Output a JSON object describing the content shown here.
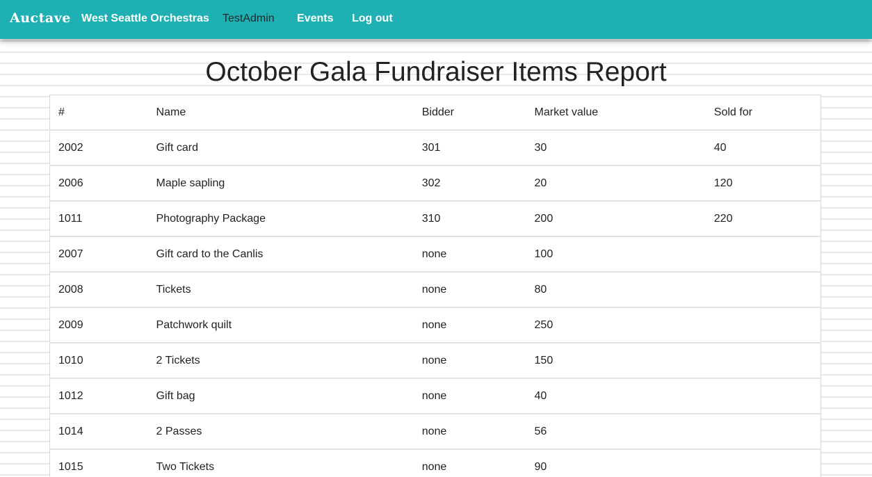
{
  "nav": {
    "brand": "Auctave",
    "links": [
      {
        "label": "West Seattle Orchestras",
        "active": false
      },
      {
        "label": "TestAdmin",
        "active": true
      },
      {
        "label": "Events",
        "active": false
      },
      {
        "label": "Log out",
        "active": false
      }
    ]
  },
  "page": {
    "title": "October Gala Fundraiser Items Report"
  },
  "table": {
    "headers": [
      "#",
      "Name",
      "Bidder",
      "Market value",
      "Sold for"
    ],
    "rows": [
      [
        "2002",
        "Gift card",
        "301",
        "30",
        "40"
      ],
      [
        "2006",
        "Maple sapling",
        "302",
        "20",
        "120"
      ],
      [
        "1011",
        "Photography Package",
        "310",
        "200",
        "220"
      ],
      [
        "2007",
        "Gift card to the Canlis",
        "none",
        "100",
        ""
      ],
      [
        "2008",
        "Tickets",
        "none",
        "80",
        ""
      ],
      [
        "2009",
        "Patchwork quilt",
        "none",
        "250",
        ""
      ],
      [
        "1010",
        "2 Tickets",
        "none",
        "150",
        ""
      ],
      [
        "1012",
        "Gift bag",
        "none",
        "40",
        ""
      ],
      [
        "1014",
        "2 Passes",
        "none",
        "56",
        ""
      ],
      [
        "1015",
        "Two Tickets",
        "none",
        "90",
        ""
      ]
    ]
  },
  "colors": {
    "navbar": "#1eb0b3",
    "active_link": "#1f2a2a"
  }
}
